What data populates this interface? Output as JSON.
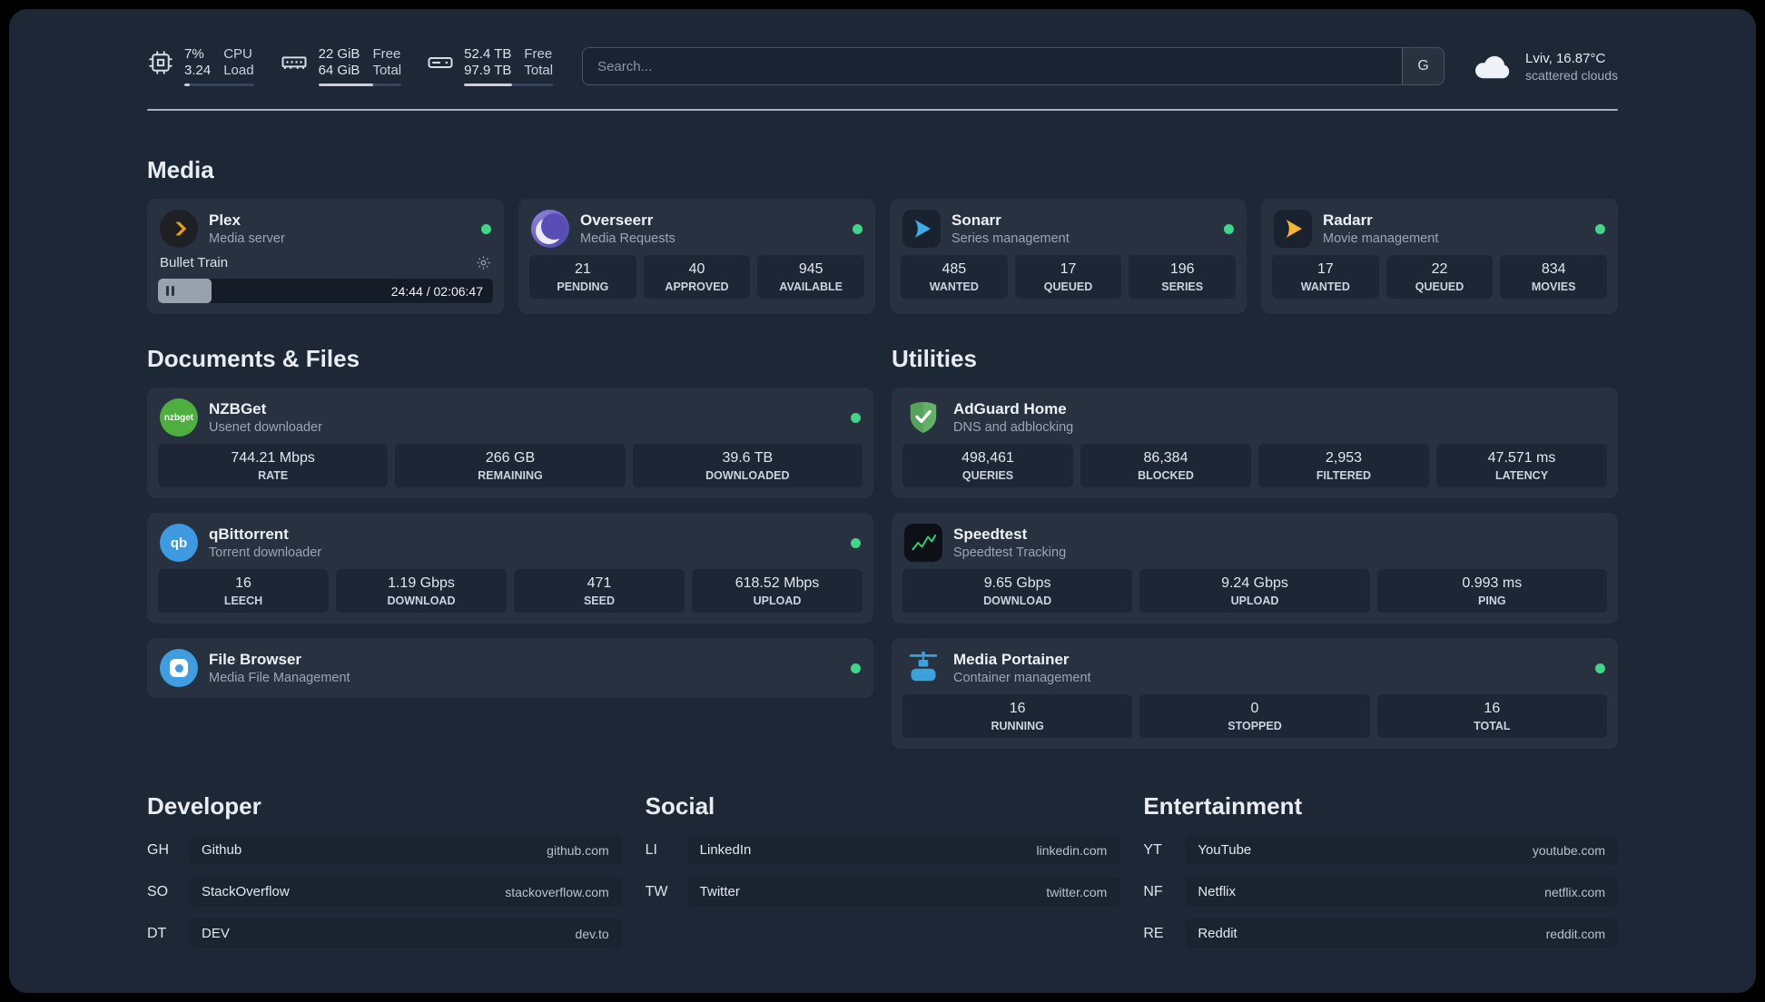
{
  "topbar": {
    "cpu": {
      "value_top": "7%",
      "value_bottom": "3.24",
      "label_top": "CPU",
      "label_bottom": "Load"
    },
    "memory": {
      "value_top": "22 GiB",
      "value_bottom": "64 GiB",
      "label_top": "Free",
      "label_bottom": "Total"
    },
    "disk": {
      "value_top": "52.4 TB",
      "value_bottom": "97.9 TB",
      "label_top": "Free",
      "label_bottom": "Total"
    },
    "search": {
      "placeholder": "Search...",
      "button_label": "G"
    },
    "weather": {
      "location": "Lviv, 16.87°C",
      "condition": "scattered clouds"
    }
  },
  "sections": {
    "media": {
      "title": "Media",
      "plex": {
        "name": "Plex",
        "subtitle": "Media server",
        "now_playing": "Bullet Train",
        "time": "24:44 / 02:06:47"
      },
      "overseerr": {
        "name": "Overseerr",
        "subtitle": "Media Requests",
        "stats": [
          {
            "value": "21",
            "label": "PENDING"
          },
          {
            "value": "40",
            "label": "APPROVED"
          },
          {
            "value": "945",
            "label": "AVAILABLE"
          }
        ]
      },
      "sonarr": {
        "name": "Sonarr",
        "subtitle": "Series management",
        "stats": [
          {
            "value": "485",
            "label": "WANTED"
          },
          {
            "value": "17",
            "label": "QUEUED"
          },
          {
            "value": "196",
            "label": "SERIES"
          }
        ]
      },
      "radarr": {
        "name": "Radarr",
        "subtitle": "Movie management",
        "stats": [
          {
            "value": "17",
            "label": "WANTED"
          },
          {
            "value": "22",
            "label": "QUEUED"
          },
          {
            "value": "834",
            "label": "MOVIES"
          }
        ]
      }
    },
    "documents": {
      "title": "Documents & Files",
      "nzbget": {
        "name": "NZBGet",
        "subtitle": "Usenet downloader",
        "stats": [
          {
            "value": "744.21 Mbps",
            "label": "RATE"
          },
          {
            "value": "266 GB",
            "label": "REMAINING"
          },
          {
            "value": "39.6 TB",
            "label": "DOWNLOADED"
          }
        ]
      },
      "qbittorrent": {
        "name": "qBittorrent",
        "subtitle": "Torrent downloader",
        "stats": [
          {
            "value": "16",
            "label": "LEECH"
          },
          {
            "value": "1.19 Gbps",
            "label": "DOWNLOAD"
          },
          {
            "value": "471",
            "label": "SEED"
          },
          {
            "value": "618.52 Mbps",
            "label": "UPLOAD"
          }
        ]
      },
      "filebrowser": {
        "name": "File Browser",
        "subtitle": "Media File Management"
      }
    },
    "utilities": {
      "title": "Utilities",
      "adguard": {
        "name": "AdGuard Home",
        "subtitle": "DNS and adblocking",
        "stats": [
          {
            "value": "498,461",
            "label": "QUERIES"
          },
          {
            "value": "86,384",
            "label": "BLOCKED"
          },
          {
            "value": "2,953",
            "label": "FILTERED"
          },
          {
            "value": "47.571 ms",
            "label": "LATENCY"
          }
        ]
      },
      "speedtest": {
        "name": "Speedtest",
        "subtitle": "Speedtest Tracking",
        "stats": [
          {
            "value": "9.65 Gbps",
            "label": "DOWNLOAD"
          },
          {
            "value": "9.24 Gbps",
            "label": "UPLOAD"
          },
          {
            "value": "0.993 ms",
            "label": "PING"
          }
        ]
      },
      "portainer": {
        "name": "Media Portainer",
        "subtitle": "Container management",
        "stats": [
          {
            "value": "16",
            "label": "RUNNING"
          },
          {
            "value": "0",
            "label": "STOPPED"
          },
          {
            "value": "16",
            "label": "TOTAL"
          }
        ]
      }
    }
  },
  "bookmarks": {
    "developer": {
      "title": "Developer",
      "items": [
        {
          "abbr": "GH",
          "name": "Github",
          "url": "github.com"
        },
        {
          "abbr": "SO",
          "name": "StackOverflow",
          "url": "stackoverflow.com"
        },
        {
          "abbr": "DT",
          "name": "DEV",
          "url": "dev.to"
        }
      ]
    },
    "social": {
      "title": "Social",
      "items": [
        {
          "abbr": "LI",
          "name": "LinkedIn",
          "url": "linkedin.com"
        },
        {
          "abbr": "TW",
          "name": "Twitter",
          "url": "twitter.com"
        }
      ]
    },
    "entertainment": {
      "title": "Entertainment",
      "items": [
        {
          "abbr": "YT",
          "name": "YouTube",
          "url": "youtube.com"
        },
        {
          "abbr": "NF",
          "name": "Netflix",
          "url": "netflix.com"
        },
        {
          "abbr": "RE",
          "name": "Reddit",
          "url": "reddit.com"
        }
      ]
    }
  },
  "colors": {
    "status_online": "#3fd68a",
    "accent_plex": "#e5a00d"
  }
}
